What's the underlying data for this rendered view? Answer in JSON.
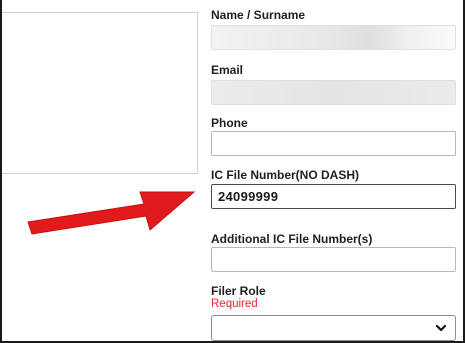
{
  "form": {
    "name_label": "Name / Surname",
    "name_value": "",
    "email_label": "Email",
    "email_value": "",
    "phone_label": "Phone",
    "phone_value": "",
    "ic_label": "IC File Number(NO DASH)",
    "ic_value": "24099999",
    "additional_label": "Additional IC File Number(s)",
    "additional_value": "",
    "filer_role_label": "Filer Role",
    "filer_role_required": "Required",
    "filer_role_value": ""
  },
  "icons": {
    "dropdown": "chevron-down-icon",
    "annotation": "red-arrow-annotation"
  },
  "colors": {
    "required_text": "#e8262e",
    "annotation_arrow": "#e11b1b",
    "frame_border": "#1a1a1a"
  }
}
